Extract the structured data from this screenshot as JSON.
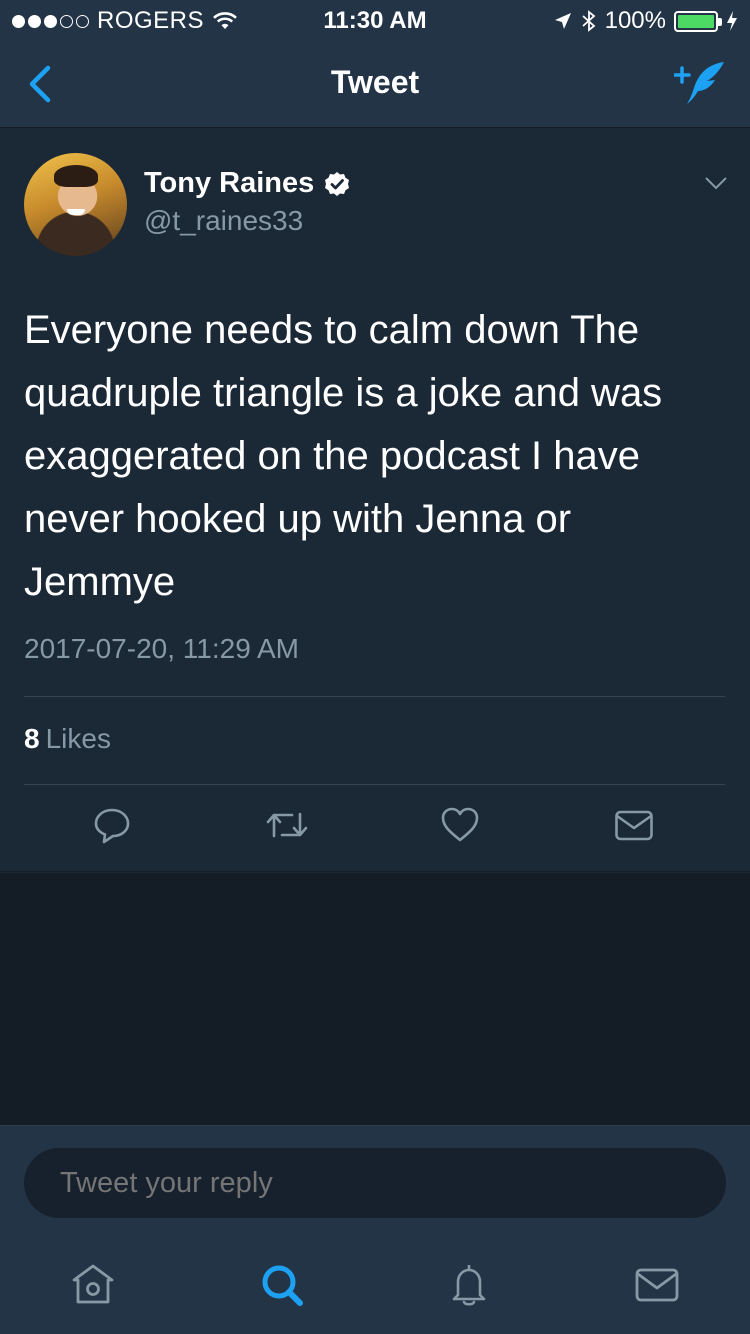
{
  "status_bar": {
    "carrier": "ROGERS",
    "time": "11:30 AM",
    "battery": "100%",
    "signal_bars_filled": 3,
    "signal_bars_total": 5,
    "battery_level": 1.0,
    "battery_color": "#4cd964"
  },
  "nav": {
    "title": "Tweet",
    "back_icon": "chevron-left-icon",
    "compose_icon": "compose-tweet-icon"
  },
  "tweet": {
    "author_name": "Tony Raines",
    "author_handle": "@t_raines33",
    "verified": true,
    "text": "Everyone needs to calm down The quadruple triangle is a joke and was exaggerated on the podcast I have never hooked up with Jenna or Jemmye",
    "timestamp": "2017-07-20, 11:29 AM",
    "likes_count": "8",
    "likes_label": "Likes",
    "actions": [
      "reply-icon",
      "retweet-icon",
      "like-icon",
      "direct-message-icon"
    ]
  },
  "reply": {
    "placeholder": "Tweet your reply"
  },
  "tab_bar": {
    "tabs": [
      "home-icon",
      "search-icon",
      "notifications-icon",
      "messages-icon"
    ],
    "active": "search-icon"
  },
  "colors": {
    "accent": "#1da1f2",
    "background": "#1b2836",
    "bar": "#243447",
    "muted_text": "#8899a6"
  }
}
